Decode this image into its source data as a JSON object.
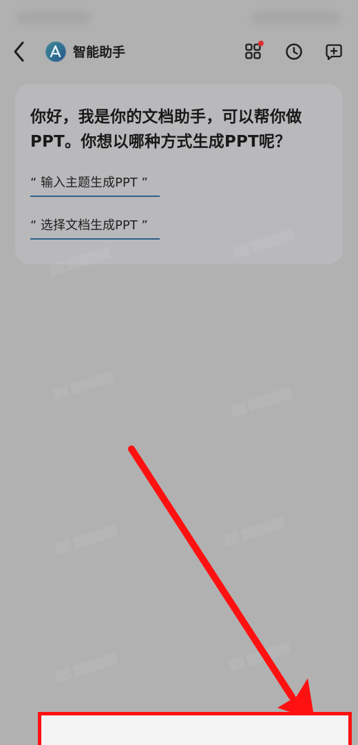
{
  "header": {
    "title": "智能助手"
  },
  "assistant_message": {
    "greeting": "你好，我是你的文档助手，可以帮你做PPT。你想以哪种方式生成PPT呢？",
    "options": [
      {
        "label": "“ 输入主题生成PPT ”"
      },
      {
        "label": "“ 选择文档生成PPT ”"
      }
    ]
  },
  "annotations": {
    "highlight_color": "#ff1111"
  },
  "icons": {
    "back": "back-icon",
    "logo": "assistant-logo-icon",
    "grid": "grid-icon",
    "history": "clock-icon",
    "new_chat": "new-chat-icon"
  },
  "colors": {
    "background": "#b1b1b1",
    "card": "#b9b9bc",
    "accent": "#2c5f8a",
    "notification": "#de2f2f"
  }
}
